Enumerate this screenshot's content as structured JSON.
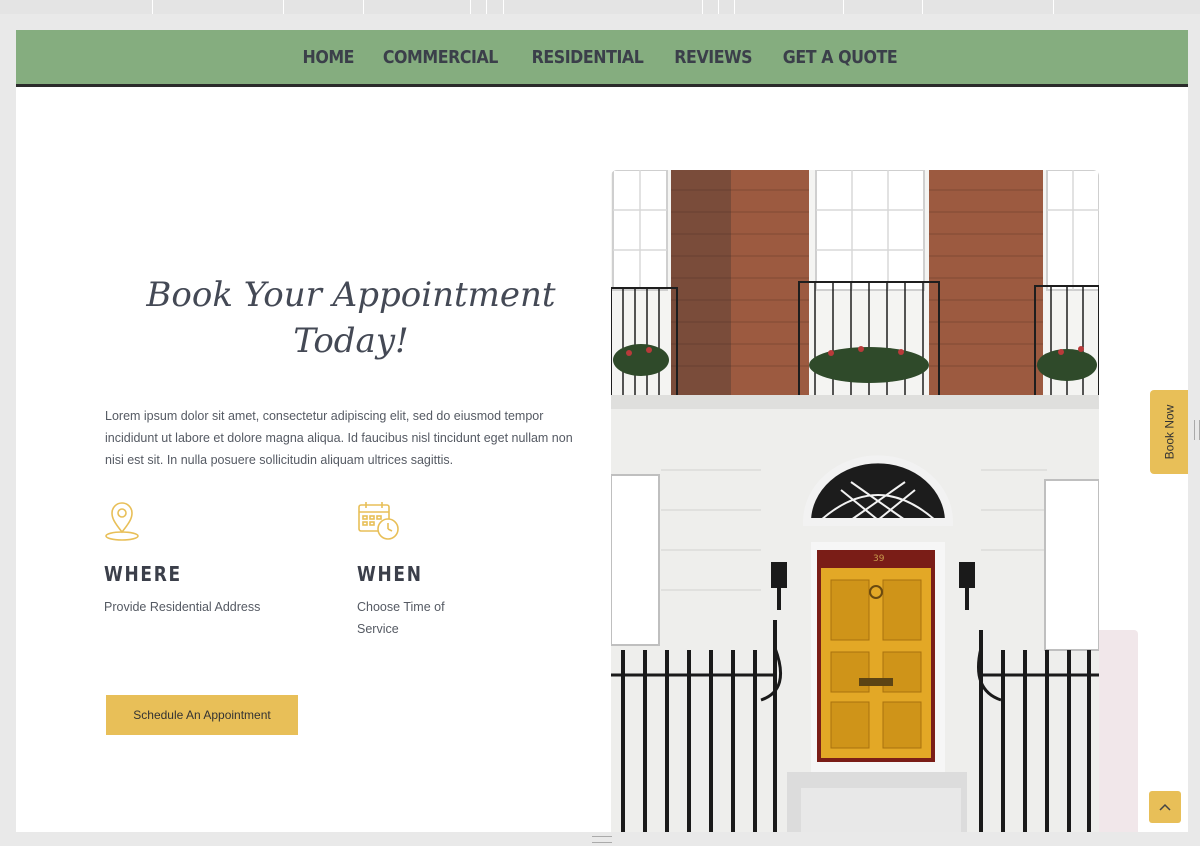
{
  "nav": {
    "items": [
      "HOME",
      "COMMERCIAL",
      "RESIDENTIAL",
      "REVIEWS",
      "GET A QUOTE"
    ]
  },
  "hero": {
    "title_line1": "Book Your Appointment",
    "title_line2": "Today!",
    "intro": "Lorem ipsum dolor sit amet, consectetur adipiscing elit, sed do eiusmod tempor incididunt ut labore et dolore magna aliqua. Id faucibus nisl tincidunt eget nullam non nisi est sit. In nulla posuere sollicitudin aliquam ultrices sagittis."
  },
  "features": {
    "where": {
      "icon": "map-pin-icon",
      "title": "WHERE",
      "desc": "Provide Residential Address"
    },
    "when": {
      "icon": "calendar-clock-icon",
      "title": "WHEN",
      "desc": "Choose Time of Service"
    }
  },
  "cta": {
    "label": "Schedule An Appointment"
  },
  "side_tab": {
    "label": "Book Now"
  },
  "house": {
    "door_number": "39"
  },
  "colors": {
    "nav_bg": "#85ad7f",
    "accent": "#e8bf58",
    "text_dark": "#3b3f4a",
    "panel_pink": "#f1e7ea",
    "door": "#e3a826"
  }
}
